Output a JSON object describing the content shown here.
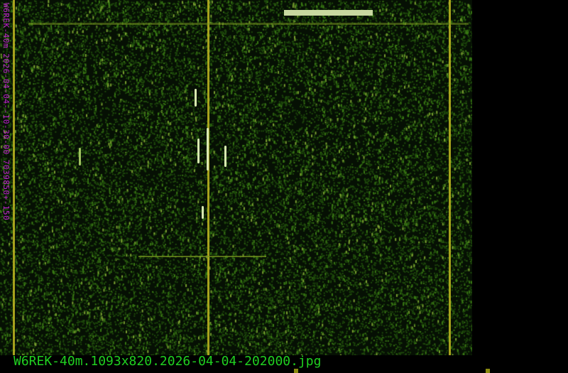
{
  "image": {
    "side_label": "W6REK-40m 2026-04-04--10-30-00 7039850+-150",
    "filename": "W6REK-40m.1093x820.2026-04-04-202000.jpg"
  },
  "colors": {
    "noise": "#2f6a10",
    "line": "#b8b020",
    "label": "#c020d0",
    "filename": "#20d020"
  }
}
